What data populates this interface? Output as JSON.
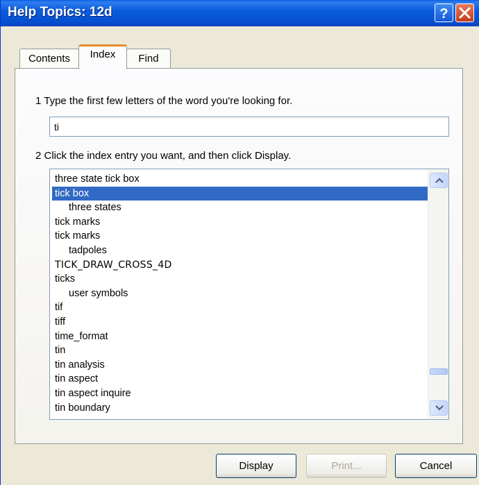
{
  "window": {
    "title": "Help Topics: 12d"
  },
  "tabs": [
    {
      "label": "Contents"
    },
    {
      "label": "Index"
    },
    {
      "label": "Find"
    }
  ],
  "index": {
    "step1_label": "1  Type the first few letters of the word you're looking for.",
    "search_value": "ti",
    "step2_label": "2  Click the index entry you want, and then click Display.",
    "entries": [
      {
        "text": "three state tick box",
        "level": 0
      },
      {
        "text": "tick box",
        "level": 0,
        "selected": true
      },
      {
        "text": "three states",
        "level": 1
      },
      {
        "text": "tick marks",
        "level": 0
      },
      {
        "text": "tick marks",
        "level": 0
      },
      {
        "text": "tadpoles",
        "level": 1
      },
      {
        "text": "TICK_DRAW_CROSS_4D",
        "level": 0
      },
      {
        "text": "ticks",
        "level": 0
      },
      {
        "text": "user symbols",
        "level": 1
      },
      {
        "text": "tif",
        "level": 0
      },
      {
        "text": "tiff",
        "level": 0
      },
      {
        "text": "time_format",
        "level": 0
      },
      {
        "text": "tin",
        "level": 0
      },
      {
        "text": "tin analysis",
        "level": 0
      },
      {
        "text": "tin aspect",
        "level": 0
      },
      {
        "text": "tin aspect inquire",
        "level": 0
      },
      {
        "text": "tin boundary",
        "level": 0
      }
    ]
  },
  "buttons": {
    "display": "Display",
    "print": "Print...",
    "cancel": "Cancel"
  },
  "colors": {
    "titlebar": "#0550d2",
    "selection": "#316ac5",
    "dialog_bg": "#ECE9D8",
    "active_tab_accent": "#e68b2c"
  },
  "icons": {
    "help": "help-icon",
    "close": "close-icon",
    "scroll_up": "chevron-up-icon",
    "scroll_down": "chevron-down-icon"
  }
}
